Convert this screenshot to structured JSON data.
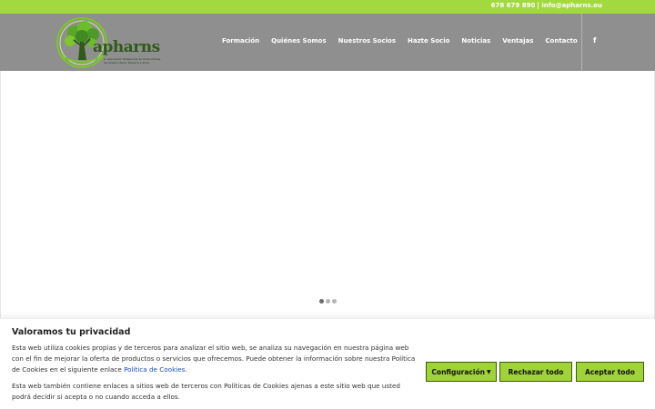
{
  "topbar": {
    "phone": "678 679 890",
    "email": "info@apharns.eu"
  },
  "header": {
    "logo": {
      "brand": "apharns",
      "tagline_line1": "A. Asociación Profesional de Horticultores",
      "tagline_line2": "de Aragón, Rioja, Navarra y Soria"
    },
    "nav": [
      {
        "label": "Formación"
      },
      {
        "label": "Quiénes Somos"
      },
      {
        "label": "Nuestros Socios"
      },
      {
        "label": "Hazte Socio"
      },
      {
        "label": "Noticias"
      },
      {
        "label": "Ventajas"
      },
      {
        "label": "Contacto"
      }
    ],
    "social": {
      "facebook_glyph": "f",
      "icon": "facebook-icon"
    }
  },
  "slider": {
    "dots": 3,
    "active_dot": 0
  },
  "cookie_banner": {
    "title": "Valoramos tu privacidad",
    "paragraph1_text": "Esta web utiliza cookies propias y de terceros para analizar el sitio web, se analiza su navegación en nuestra página web con el fin de mejorar la oferta de productos o servicios que ofrecemos. Puede obtener la información sobre nuestra Política de Cookies en el siguiente enlace ",
    "paragraph1_link": "Política de Cookies",
    "paragraph1_end": ".",
    "paragraph2_text": "Esta web también contiene enlaces a sitios web de terceros con Políticas de Cookies ajenas a este sitio web que usted podrá decidir si acepta o no cuando acceda a ellos.",
    "buttons": {
      "config": "Configuración",
      "reject": "Rechazar todo",
      "accept": "Aceptar todo"
    }
  },
  "colors": {
    "topbar": "#a2d93f",
    "header": "#8f8f8f",
    "button": "#9fd338",
    "link": "#1a4fb5"
  }
}
